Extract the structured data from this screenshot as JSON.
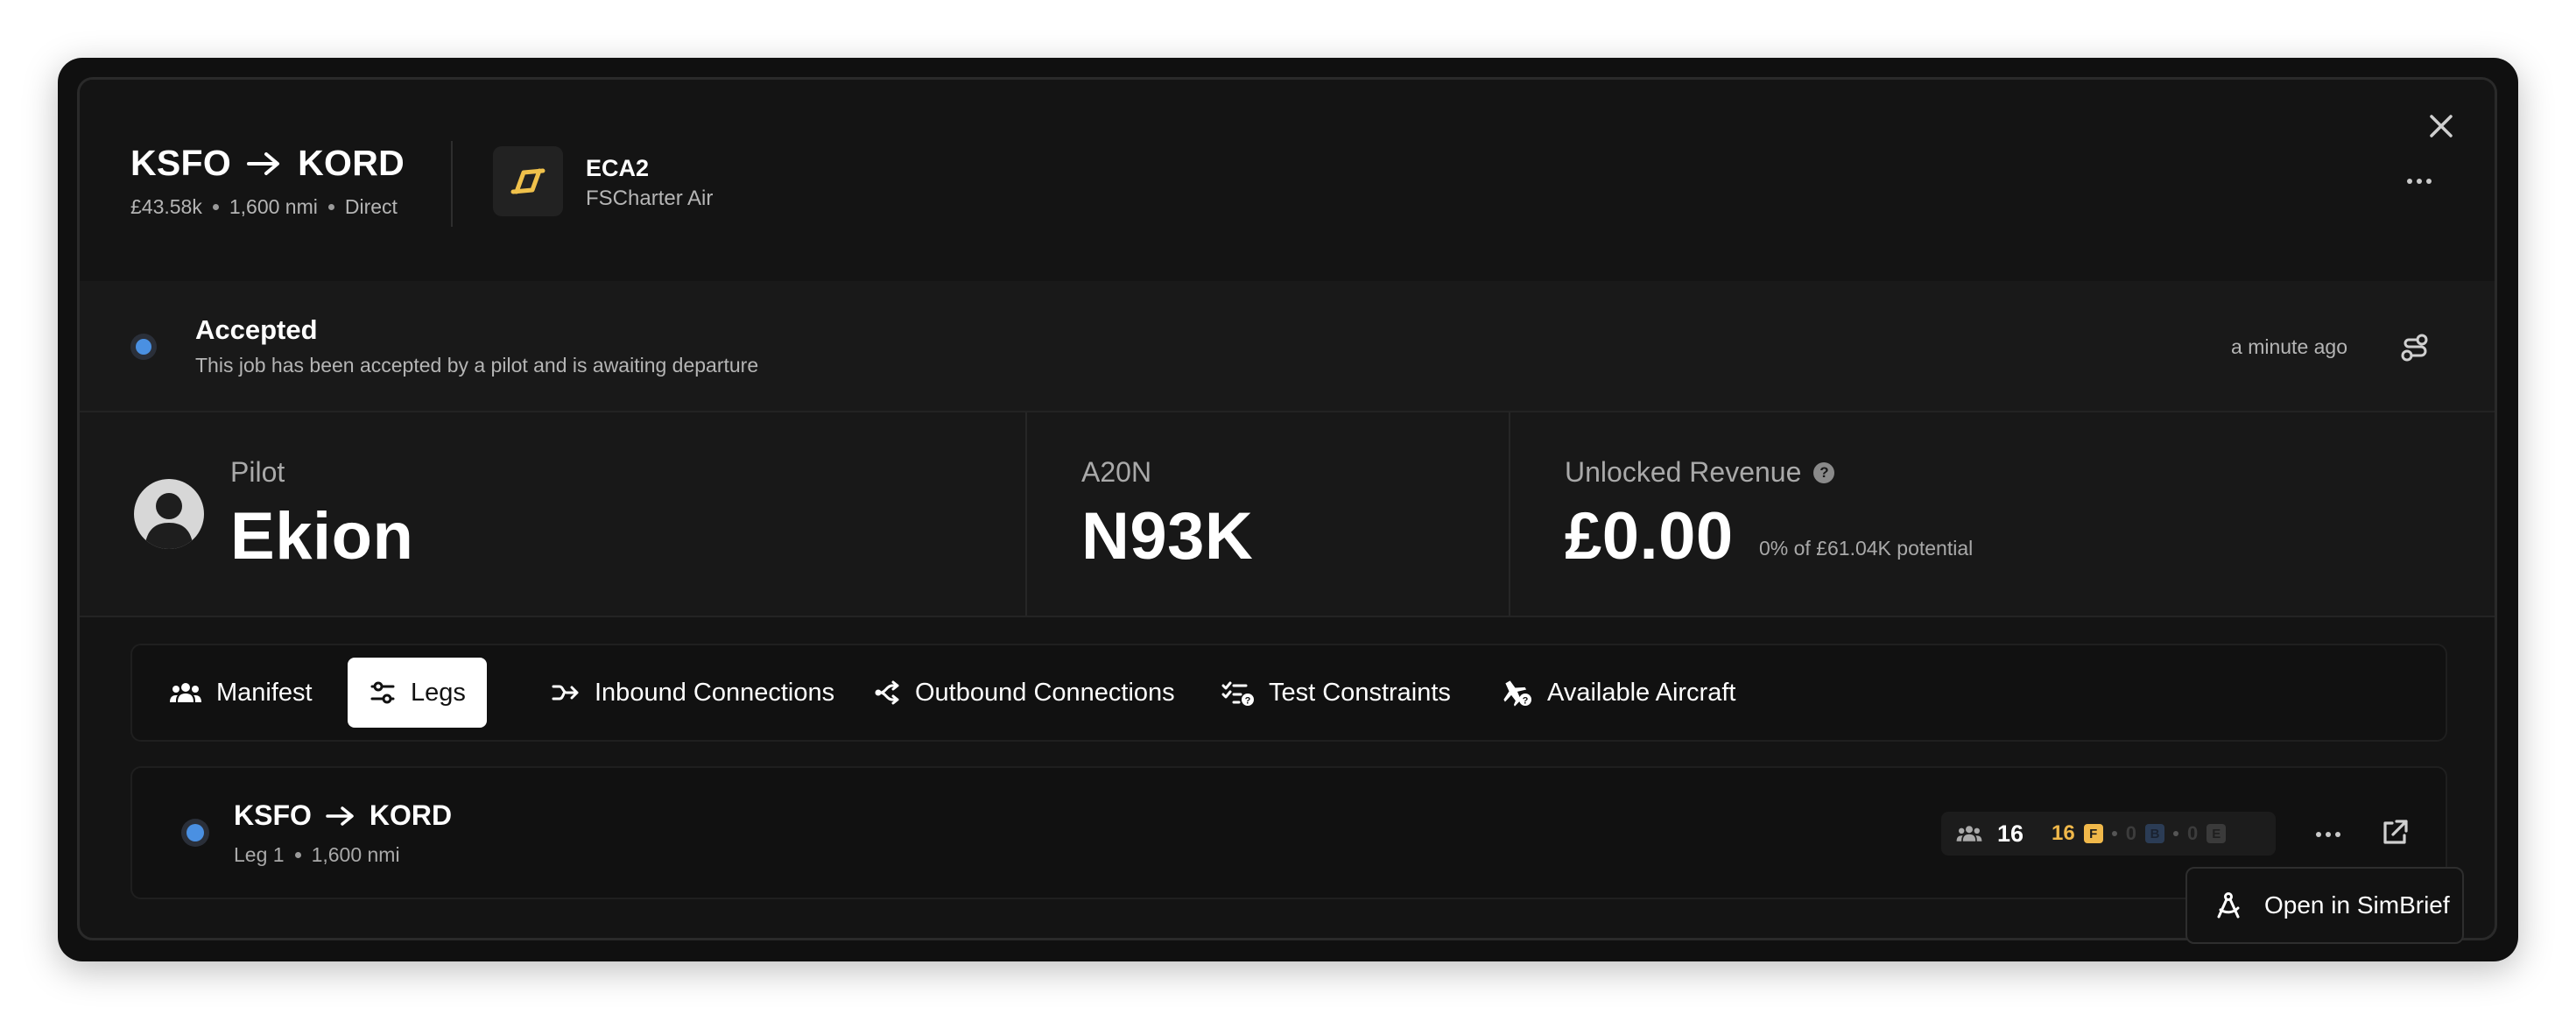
{
  "header": {
    "origin": "KSFO",
    "destination": "KORD",
    "value": "£43.58k",
    "distance": "1,600 nmi",
    "route_type": "Direct",
    "airline_code": "ECA2",
    "airline_name": "FSCharter Air",
    "logo_color": "#f0c14b"
  },
  "status": {
    "title": "Accepted",
    "description": "This job has been accepted by a pilot and is awaiting departure",
    "time": "a minute ago",
    "color": "#4a90e2"
  },
  "stats": {
    "pilot_label": "Pilot",
    "pilot_name": "Ekion",
    "aircraft_type": "A20N",
    "aircraft_reg": "N93K",
    "revenue_label": "Unlocked Revenue",
    "revenue_help": "?",
    "revenue_value": "£0.00",
    "revenue_potential": "0% of £61.04K potential"
  },
  "tabs": [
    {
      "label": "Manifest",
      "icon": "users-icon",
      "active": false
    },
    {
      "label": "Legs",
      "icon": "sliders-icon",
      "active": true
    },
    {
      "label": "Inbound Connections",
      "icon": "inbound-icon",
      "active": false
    },
    {
      "label": "Outbound Connections",
      "icon": "outbound-icon",
      "active": false
    },
    {
      "label": "Test Constraints",
      "icon": "checklist-icon",
      "active": false
    },
    {
      "label": "Available Aircraft",
      "icon": "plane-question-icon",
      "active": false
    }
  ],
  "leg": {
    "origin": "KSFO",
    "destination": "KORD",
    "leg_label": "Leg 1",
    "distance": "1,600 nmi",
    "pax_total": "16",
    "pax_first": "16",
    "first_code": "F",
    "pax_business": "0",
    "business_code": "B",
    "pax_economy": "0",
    "economy_code": "E"
  },
  "simbrief": {
    "label": "Open in SimBrief"
  }
}
